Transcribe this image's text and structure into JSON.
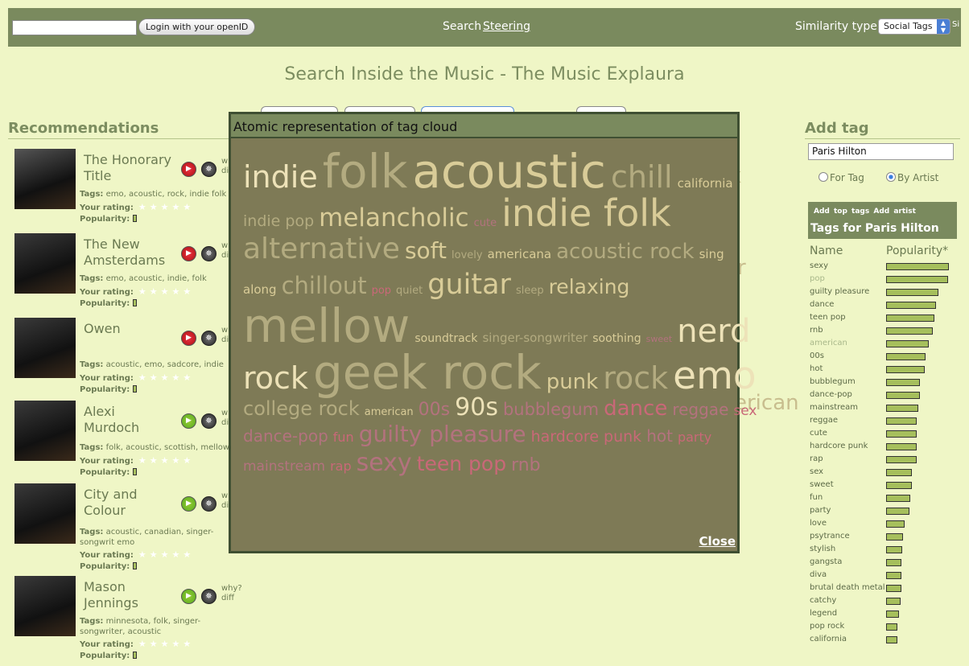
{
  "topbar": {
    "login_button": "Login with your openID",
    "search": "Search",
    "steering": "Steering",
    "similarity_label": "Similarity type :",
    "similarity_value": "Social Tags",
    "similarity_cut": "Si"
  },
  "page_title": "Search Inside the Music - The Music Explaura",
  "recommendations": {
    "heading": "Recommendations",
    "rating_label": "Your rating:",
    "popularity_label": "Popularity:",
    "tags_label": "Tags:",
    "items": [
      {
        "name": "The Honorary Title",
        "tags": "emo, acoustic, rock, indie folk",
        "play": "red",
        "why": "w",
        "diff": "di"
      },
      {
        "name": "The New Amsterdams",
        "tags": "emo, acoustic, indie, folk",
        "play": "red",
        "why": "w",
        "diff": "di"
      },
      {
        "name": "Owen",
        "tags": "acoustic, emo, sadcore, indie",
        "play": "red",
        "why": "w",
        "diff": "di"
      },
      {
        "name": "Alexi Murdoch",
        "tags": "folk, acoustic, scottish, mellow",
        "play": "green",
        "why": "w",
        "diff": "di"
      },
      {
        "name": "City and Colour",
        "tags": "acoustic, canadian, singer-songwrit emo",
        "play": "green",
        "why": "w",
        "diff": "di"
      },
      {
        "name": "Mason Jennings",
        "tags": "minnesota, folk, singer-songwriter, acoustic",
        "play": "green",
        "why": "why?",
        "diff": "diff"
      }
    ]
  },
  "add_tag": {
    "heading": "Add tag",
    "input_value": "Paris Hilton",
    "for_tag": "For Tag",
    "by_artist": "By Artist",
    "add_top_tags": "Add top tags",
    "add_artist": "Add artist",
    "panel_title": "Tags for Paris Hilton",
    "col_name": "Name",
    "col_pop": "Popularity*"
  },
  "tag_popularity": [
    {
      "name": "sexy",
      "value": 0.97,
      "dim": false
    },
    {
      "name": "pop",
      "value": 0.96,
      "dim": true
    },
    {
      "name": "guilty pleasure",
      "value": 0.81,
      "dim": false
    },
    {
      "name": "dance",
      "value": 0.77,
      "dim": false
    },
    {
      "name": "teen pop",
      "value": 0.75,
      "dim": false
    },
    {
      "name": "rnb",
      "value": 0.72,
      "dim": false
    },
    {
      "name": "american",
      "value": 0.66,
      "dim": true
    },
    {
      "name": "00s",
      "value": 0.61,
      "dim": false
    },
    {
      "name": "hot",
      "value": 0.6,
      "dim": false
    },
    {
      "name": "bubblegum",
      "value": 0.53,
      "dim": false
    },
    {
      "name": "dance-pop",
      "value": 0.52,
      "dim": false
    },
    {
      "name": "mainstream",
      "value": 0.5,
      "dim": false
    },
    {
      "name": "reggae",
      "value": 0.48,
      "dim": false
    },
    {
      "name": "cute",
      "value": 0.48,
      "dim": false
    },
    {
      "name": "hardcore punk",
      "value": 0.47,
      "dim": false
    },
    {
      "name": "rap",
      "value": 0.47,
      "dim": false
    },
    {
      "name": "sex",
      "value": 0.4,
      "dim": false
    },
    {
      "name": "sweet",
      "value": 0.4,
      "dim": false
    },
    {
      "name": "fun",
      "value": 0.38,
      "dim": false
    },
    {
      "name": "party",
      "value": 0.36,
      "dim": false
    },
    {
      "name": "love",
      "value": 0.29,
      "dim": false
    },
    {
      "name": "psytrance",
      "value": 0.26,
      "dim": false
    },
    {
      "name": "stylish",
      "value": 0.25,
      "dim": false
    },
    {
      "name": "gangsta",
      "value": 0.24,
      "dim": false
    },
    {
      "name": "diva",
      "value": 0.24,
      "dim": false
    },
    {
      "name": "brutal death metal",
      "value": 0.24,
      "dim": false
    },
    {
      "name": "catchy",
      "value": 0.23,
      "dim": false
    },
    {
      "name": "legend",
      "value": 0.2,
      "dim": false
    },
    {
      "name": "pop rock",
      "value": 0.17,
      "dim": false
    },
    {
      "name": "california",
      "value": 0.17,
      "dim": false
    }
  ],
  "modal": {
    "title": "Atomic representation of tag cloud",
    "close": "Close"
  },
  "cloud_colors": {
    "tan": "#d9cc98",
    "light": "#ede2b8",
    "olive": "#b3ab80",
    "pink": "#c96878",
    "pinkdim": "#b3727e"
  },
  "cloud": [
    [
      {
        "t": "indie",
        "s": 38,
        "c": "light"
      },
      {
        "t": "folk",
        "s": 58,
        "c": "olive"
      },
      {
        "t": "acoustic",
        "s": 58,
        "c": "tan"
      },
      {
        "t": "chill",
        "s": 38,
        "c": "olive"
      },
      {
        "t": "california",
        "s": 15,
        "c": "tan"
      }
    ],
    [
      {
        "t": "indie pop",
        "s": 19,
        "c": "olive"
      },
      {
        "t": "melancholic",
        "s": 31,
        "c": "tan"
      },
      {
        "t": "cute",
        "s": 13,
        "c": "pinkdim"
      },
      {
        "t": "indie folk",
        "s": 46,
        "c": "tan"
      }
    ],
    [
      {
        "t": "alternative",
        "s": 36,
        "c": "olive"
      },
      {
        "t": "soft",
        "s": 28,
        "c": "tan"
      },
      {
        "t": "lovely",
        "s": 13,
        "c": "olive"
      },
      {
        "t": "americana",
        "s": 15,
        "c": "tan"
      },
      {
        "t": "acoustic rock",
        "s": 26,
        "c": "olive"
      },
      {
        "t": "sing",
        "s": 15,
        "c": "tan"
      }
    ],
    [
      {
        "t": "along",
        "s": 15,
        "c": "tan"
      },
      {
        "t": "chillout",
        "s": 29,
        "c": "olive"
      },
      {
        "t": "pop",
        "s": 13,
        "c": "pink"
      },
      {
        "t": "quiet",
        "s": 13,
        "c": "olive"
      },
      {
        "t": "guitar",
        "s": 35,
        "c": "tan"
      },
      {
        "t": "sleep",
        "s": 13,
        "c": "olive"
      },
      {
        "t": "relaxing",
        "s": 25,
        "c": "tan"
      }
    ],
    [
      {
        "t": "mellow",
        "s": 58,
        "c": "olive"
      },
      {
        "t": "soundtrack",
        "s": 14,
        "c": "tan"
      },
      {
        "t": "singer-songwriter",
        "s": 15,
        "c": "olive"
      },
      {
        "t": "soothing",
        "s": 14,
        "c": "tan"
      },
      {
        "t": "sweet",
        "s": 11,
        "c": "pinkdim"
      },
      {
        "t": "nerd",
        "s": 40,
        "c": "light"
      }
    ],
    [
      {
        "t": "rock",
        "s": 38,
        "c": "light"
      },
      {
        "t": "geek rock",
        "s": 58,
        "c": "olive"
      },
      {
        "t": "punk",
        "s": 26,
        "c": "tan"
      },
      {
        "t": "rock",
        "s": 38,
        "c": "olive"
      },
      {
        "t": "emo",
        "s": 47,
        "c": "light"
      }
    ],
    [
      {
        "t": "college rock",
        "s": 24,
        "c": "olive"
      },
      {
        "t": "american",
        "s": 13,
        "c": "tan"
      },
      {
        "t": "00s",
        "s": 22,
        "c": "pinkdim"
      },
      {
        "t": "90s",
        "s": 30,
        "c": "light"
      },
      {
        "t": "bubblegum",
        "s": 21,
        "c": "pinkdim"
      },
      {
        "t": "dance",
        "s": 26,
        "c": "pink"
      },
      {
        "t": "reggae",
        "s": 20,
        "c": "pinkdim"
      },
      {
        "t": "sex",
        "s": 17,
        "c": "pink"
      }
    ],
    [
      {
        "t": "dance-pop",
        "s": 20,
        "c": "pinkdim"
      },
      {
        "t": "fun",
        "s": 16,
        "c": "pink"
      },
      {
        "t": "guilty pleasure",
        "s": 28,
        "c": "pinkdim"
      },
      {
        "t": "hardcore punk",
        "s": 19,
        "c": "pink"
      },
      {
        "t": "hot",
        "s": 20,
        "c": "pinkdim"
      },
      {
        "t": "party",
        "s": 16,
        "c": "pink"
      }
    ],
    [
      {
        "t": "mainstream",
        "s": 17,
        "c": "pinkdim"
      },
      {
        "t": "rap",
        "s": 16,
        "c": "pink"
      },
      {
        "t": "sexy",
        "s": 30,
        "c": "pinkdim"
      },
      {
        "t": "teen pop",
        "s": 25,
        "c": "pink"
      },
      {
        "t": "rnb",
        "s": 22,
        "c": "pinkdim"
      }
    ]
  ],
  "behind_text": [
    {
      "t": "k"
    },
    {
      "t": "r"
    },
    {
      "t": "erican"
    }
  ]
}
